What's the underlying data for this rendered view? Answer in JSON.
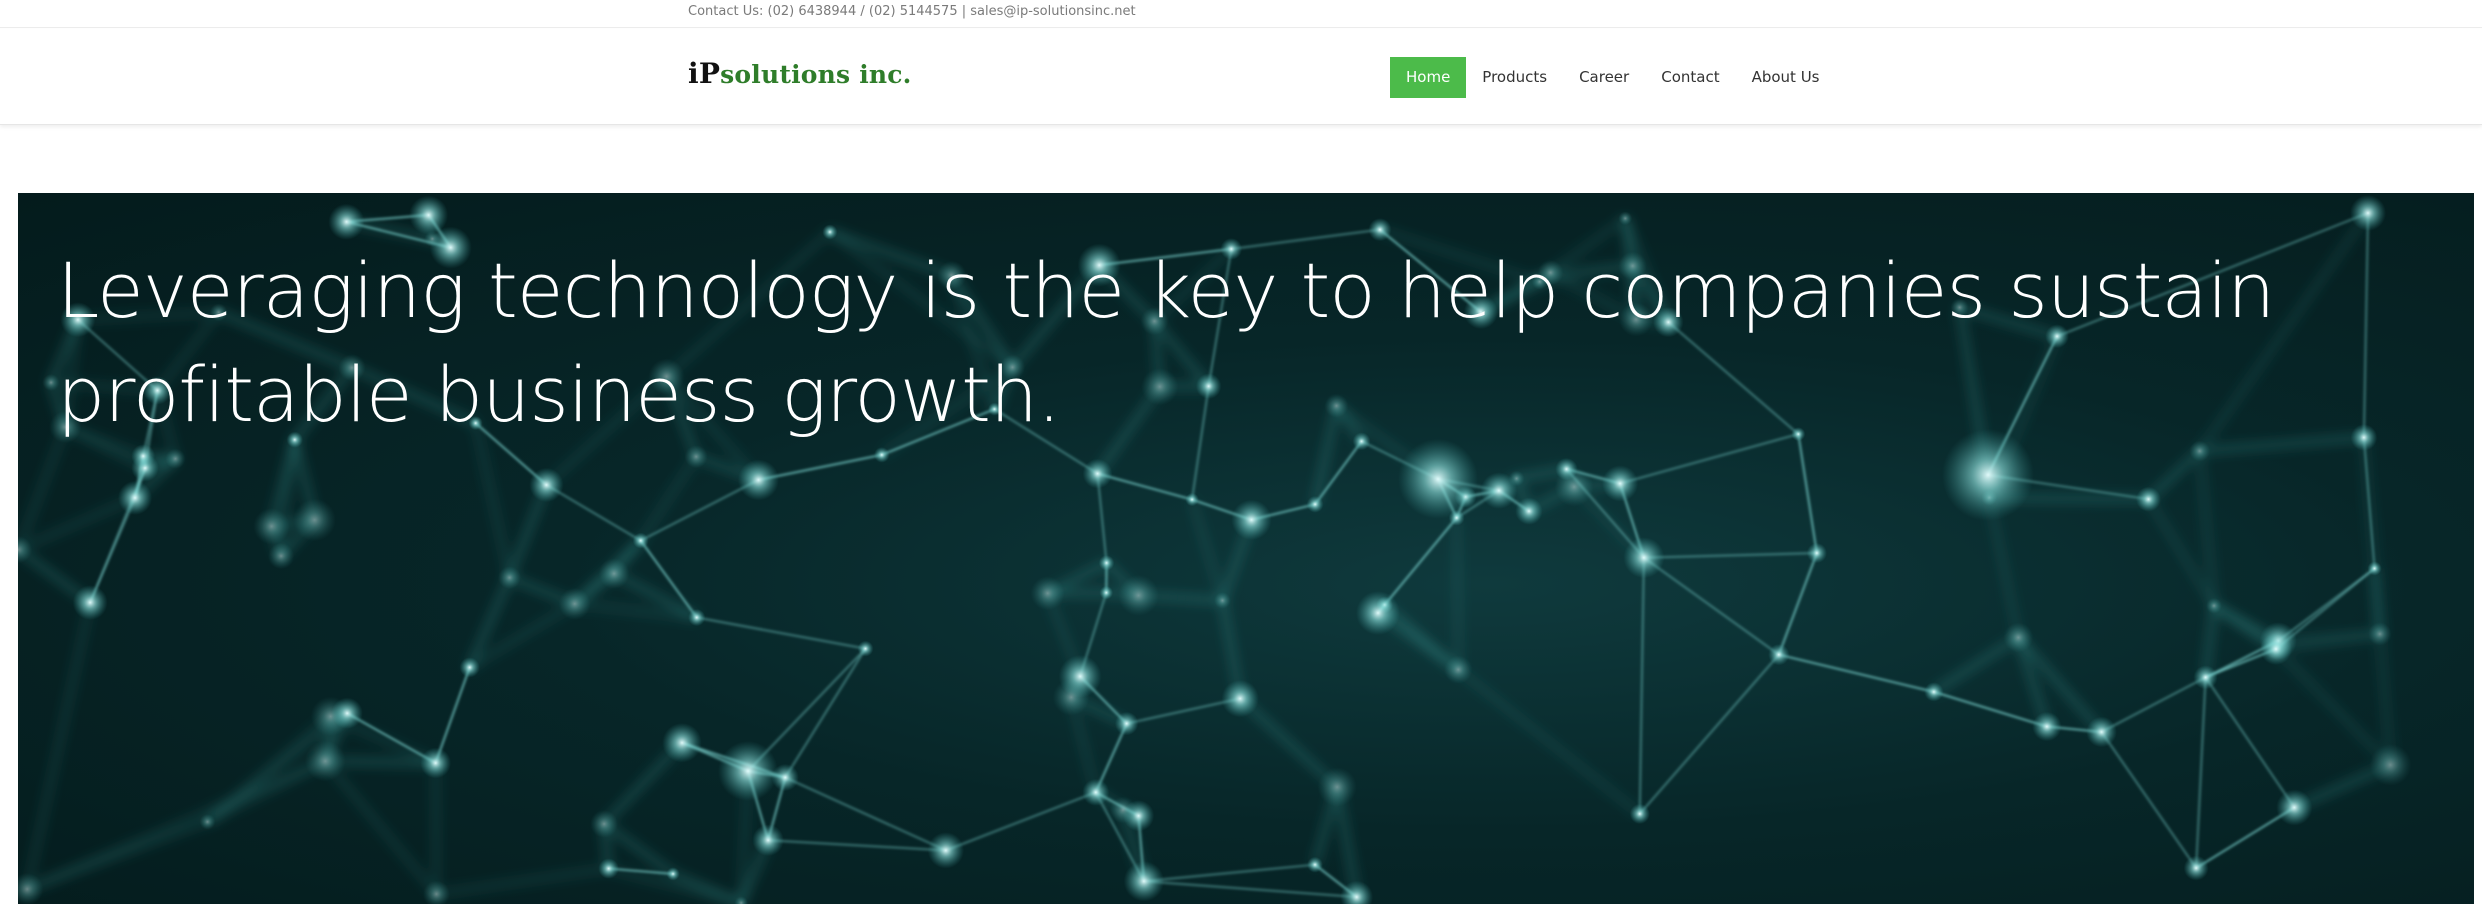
{
  "topbar": {
    "contact_text": "Contact Us: (02) 6438944 / (02) 5144575 | sales@ip-solutionsinc.net"
  },
  "header": {
    "logo": {
      "prefix": "iP",
      "name": "solutions inc."
    },
    "nav": [
      {
        "label": "Home",
        "active": true
      },
      {
        "label": "Products",
        "active": false
      },
      {
        "label": "Career",
        "active": false
      },
      {
        "label": "Contact",
        "active": false
      },
      {
        "label": "About Us",
        "active": false
      }
    ]
  },
  "hero": {
    "heading": "Leveraging technology is the key to help companies sustain profitable business growth."
  },
  "colors": {
    "accent": "#4cbb4a",
    "logo_green": "#2f7d2a",
    "hero_bg": "#072628",
    "network_teal": "#6fd6d0"
  }
}
